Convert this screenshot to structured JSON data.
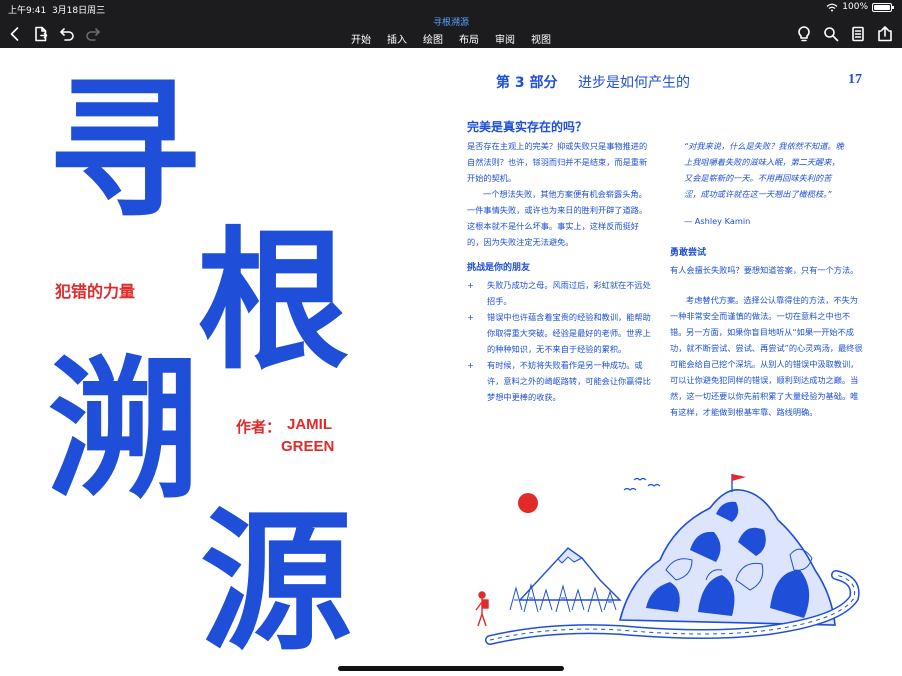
{
  "status": {
    "time": "上午9:41",
    "date": "3月18日周三",
    "battery": "100%"
  },
  "app": {
    "doc_title": "寻根溯源"
  },
  "tabs": [
    "开始",
    "插入",
    "绘图",
    "布局",
    "审阅",
    "视图"
  ],
  "toolbar": {
    "left_icons": [
      "back-icon",
      "document-icon",
      "undo-icon",
      "redo-icon"
    ],
    "right_icons": [
      "lightbulb-icon",
      "search-icon",
      "document-outline-icon",
      "share-icon"
    ]
  },
  "cover": {
    "title_chars": [
      "寻",
      "根",
      "溯",
      "源"
    ],
    "subtitle": "犯错的力量",
    "author_label": "作者：",
    "author_first": "JAMIL",
    "author_last": "GREEN"
  },
  "page": {
    "part_label": "第 3 部分",
    "part_title": "进步是如何产生的",
    "number": "17",
    "heading_perfect": "完美是真实存在的吗？",
    "p1": "是否存在主观上的完美？抑或失败只是事物推进的自然法则？也许，铩羽而归并不是结束，而是重新开始的契机。",
    "p2": "一个想法失败，其他方案便有机会崭露头角。一件事情失败，或许也为来日的胜利开辟了道路。这根本就不是什么坏事。事实上，这样反而挺好的，因为失败注定无法避免。",
    "heading_friend": "挑战是你的朋友",
    "bullets": [
      "失败乃成功之母。风雨过后，彩虹就在不远处招手。",
      "错误中也许蕴含着宝贵的经验和教训，能帮助你取得重大突破。经验是最好的老师。世界上的种种知识，无不来自于经验的累积。",
      "有时候，不妨将失败看作是另一种成功。或许，意料之外的崎岖路转，可能会让你赢得比梦想中更棒的收获。"
    ],
    "quote": "“对我来说，什么是失败？我依然不知道。晚上我咀嚼着失败的滋味入眠，第二天醒来，又会是崭新的一天。不用再回味失利的苦涩，成功或许就在这一天翘出了橄榄枝。”",
    "quote_author": "— Ashley Kamin",
    "heading_brave": "勇敢尝试",
    "p3": "有人会擅长失败吗？要想知道答案，只有一个方法。",
    "p4": "考虑替代方案。选择公认靠得住的方法，不失为一种非常安全而谨慎的做法。一切在意料之中也不错。",
    "p5": "另一方面，如果你盲目地听从“如果一开始不成功，就不断尝试、尝试、再尝试”的心灵鸡汤，最终很可能会给自己挖个深坑。从别人的错误中汲取教训，可以让你避免犯同样的错误，顺利到达成功之巅。当然，这一切还要以你先前积累了大量经验为基础。唯有这样，才能做到根基牢靠、路线明确。"
  },
  "colors": {
    "accent": "#1f4fd9",
    "red": "#e22a2a",
    "toolbar_bg": "#1c1c1e"
  }
}
